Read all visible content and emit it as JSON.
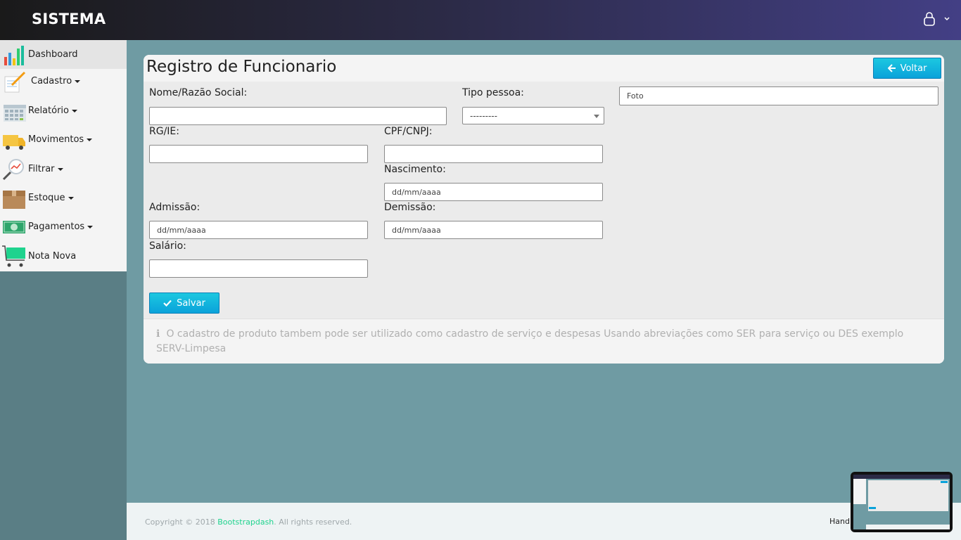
{
  "app": {
    "brand": "SISTEMA"
  },
  "navbar": {
    "user_icon": "user-icon",
    "dropdown_icon": "chevron-down-icon"
  },
  "sidebar": {
    "items": [
      {
        "label": "Dashboard",
        "icon": "bar-chart-icon",
        "dropdown": false
      },
      {
        "label": "Cadastro",
        "icon": "notepad-pencil-icon",
        "dropdown": true
      },
      {
        "label": "Relatório",
        "icon": "calendar-grid-icon",
        "dropdown": true
      },
      {
        "label": "Movimentos",
        "icon": "truck-icon",
        "dropdown": true
      },
      {
        "label": "Filtrar",
        "icon": "magnifier-chart-icon",
        "dropdown": true
      },
      {
        "label": "Estoque",
        "icon": "box-icon",
        "dropdown": true
      },
      {
        "label": "Pagamentos",
        "icon": "money-icon",
        "dropdown": true
      },
      {
        "label": "Nota Nova",
        "icon": "cart-icon",
        "dropdown": false
      }
    ]
  },
  "form": {
    "title": "Registro de Funcionario",
    "back_label": "Voltar",
    "fields": {
      "nome": {
        "label": "Nome/Razão Social:",
        "value": ""
      },
      "tipo": {
        "label": "Tipo pessoa:",
        "value": "---------"
      },
      "foto": {
        "value": "Foto"
      },
      "rg": {
        "label": "RG/IE:",
        "value": ""
      },
      "cpf": {
        "label": "CPF/CNPJ:",
        "value": ""
      },
      "nascimento": {
        "label": "Nascimento:",
        "placeholder": "dd/mm/aaaa"
      },
      "admissao": {
        "label": "Admissão:",
        "placeholder": "dd/mm/aaaa"
      },
      "demissao": {
        "label": "Demissão:",
        "placeholder": "dd/mm/aaaa"
      },
      "salario": {
        "label": "Salário:",
        "value": ""
      }
    },
    "save_label": "Salvar",
    "note": "O cadastro de produto tambem pode ser utilizado como cadastro de serviço e despesas Usando abreviações como SER para serviço ou DES exemplo SERV-Limpesa"
  },
  "footer": {
    "copyright_prefix": "Copyright © 2018 ",
    "copyright_link": "Bootstrapdash",
    "copyright_suffix": ". All rights reserved.",
    "right_text": "Hand"
  },
  "colors": {
    "accent": "#0aa2da",
    "link": "#1fd38e",
    "background": "#6f9ba3"
  }
}
